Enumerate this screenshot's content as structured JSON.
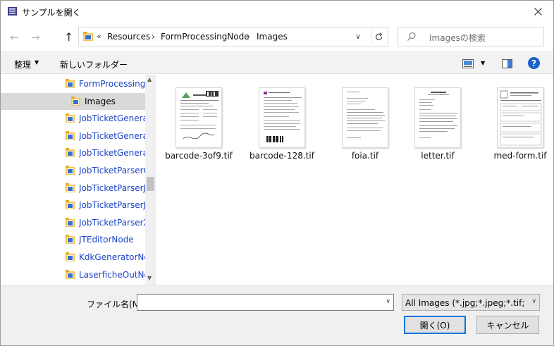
{
  "window": {
    "title": "サンプルを開く"
  },
  "address": {
    "crumbs": [
      "Resources",
      "FormProcessingNode",
      "Images"
    ],
    "overflow": "«"
  },
  "search": {
    "placeholder": "Imagesの検索"
  },
  "toolbar": {
    "organize": "整理",
    "new_folder": "新しいフォルダー",
    "help": "?"
  },
  "nav": {
    "items": [
      {
        "label": "FormProcessingN",
        "selected": false
      },
      {
        "label": "Images",
        "selected": true
      },
      {
        "label": "JobTicketGenerat",
        "selected": false
      },
      {
        "label": "JobTicketGenerat",
        "selected": false
      },
      {
        "label": "JobTicketGenerat",
        "selected": false
      },
      {
        "label": "JobTicketParserC",
        "selected": false
      },
      {
        "label": "JobTicketParserJD",
        "selected": false
      },
      {
        "label": "JobTicketParserJS",
        "selected": false
      },
      {
        "label": "JobTicketParserX",
        "selected": false
      },
      {
        "label": "JTEditorNode",
        "selected": false
      },
      {
        "label": "KdkGeneratorNo",
        "selected": false
      },
      {
        "label": "LaserficheOutNo",
        "selected": false
      }
    ]
  },
  "files": [
    {
      "name": "barcode-3of9.tif"
    },
    {
      "name": "barcode-128.tif"
    },
    {
      "name": "foia.tif"
    },
    {
      "name": "letter.tif"
    },
    {
      "name": "med-form.tif"
    }
  ],
  "bottom": {
    "filename_label": "ファイル名(N):",
    "filename_value": "",
    "filetype": "All Images (*.jpg;*.jpeg;*.tif;*.tifl",
    "open_label": "開く(O)",
    "cancel_label": "キャンセル"
  },
  "colors": {
    "accent": "#0078d7",
    "link": "#1c43c8",
    "folder": "#f6c64e",
    "help": "#1a64c8"
  }
}
